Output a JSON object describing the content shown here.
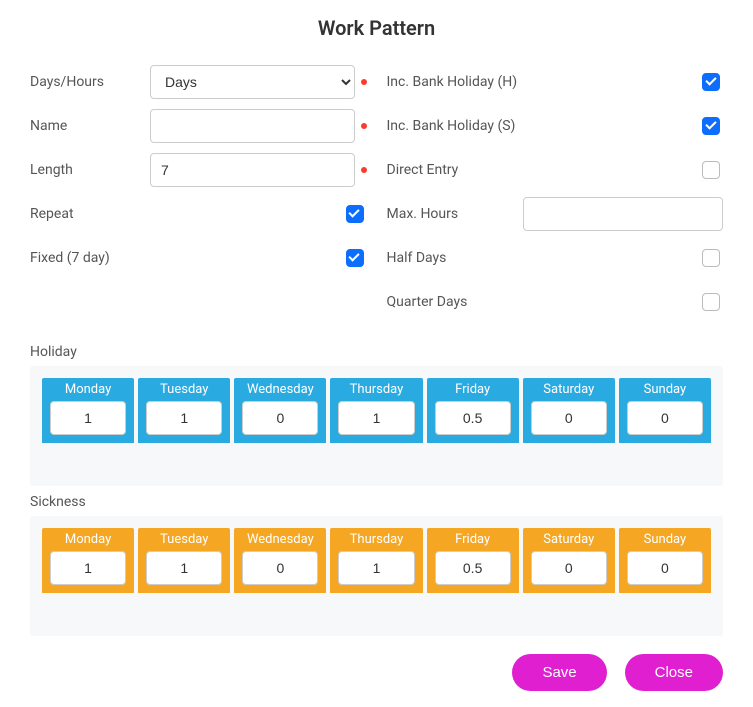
{
  "title": "Work Pattern",
  "left": {
    "days_hours_label": "Days/Hours",
    "days_hours_value": "Days",
    "name_label": "Name",
    "name_value": "",
    "length_label": "Length",
    "length_value": "7",
    "repeat_label": "Repeat",
    "repeat_checked": true,
    "fixed_label": "Fixed (7 day)",
    "fixed_checked": true
  },
  "right": {
    "bank_h_label": "Inc. Bank Holiday (H)",
    "bank_h_checked": true,
    "bank_s_label": "Inc. Bank Holiday (S)",
    "bank_s_checked": true,
    "direct_entry_label": "Direct Entry",
    "direct_entry_checked": false,
    "max_hours_label": "Max. Hours",
    "max_hours_value": "",
    "half_days_label": "Half Days",
    "half_days_checked": false,
    "quarter_days_label": "Quarter Days",
    "quarter_days_checked": false
  },
  "days": [
    "Monday",
    "Tuesday",
    "Wednesday",
    "Thursday",
    "Friday",
    "Saturday",
    "Sunday"
  ],
  "holiday": {
    "label": "Holiday",
    "values": [
      "1",
      "1",
      "0",
      "1",
      "0.5",
      "0",
      "0"
    ]
  },
  "sickness": {
    "label": "Sickness",
    "values": [
      "1",
      "1",
      "0",
      "1",
      "0.5",
      "0",
      "0"
    ]
  },
  "buttons": {
    "save": "Save",
    "close": "Close"
  },
  "colors": {
    "accent": "#e01fd0",
    "holiday_header": "#29abe2",
    "sickness_header": "#f5a623",
    "checkbox_checked": "#0d6efd"
  }
}
